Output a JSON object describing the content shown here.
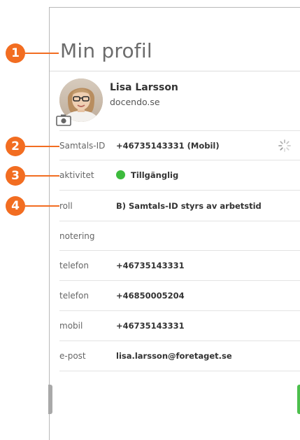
{
  "callouts": [
    "1",
    "2",
    "3",
    "4"
  ],
  "page": {
    "title": "Min profil"
  },
  "profile": {
    "name": "Lisa Larsson",
    "organization": "docendo.se"
  },
  "fields": [
    {
      "label": "Samtals-ID",
      "value": "+46735143331 (Mobil)"
    },
    {
      "label": "aktivitet",
      "value": "Tillgänglig"
    },
    {
      "label": "roll",
      "value": "B) Samtals-ID styrs av arbetstid"
    },
    {
      "label": "notering",
      "value": ""
    },
    {
      "label": "telefon",
      "value": "+46735143331"
    },
    {
      "label": "telefon",
      "value": "+46850005204"
    },
    {
      "label": "mobil",
      "value": "+46735143331"
    },
    {
      "label": "e-post",
      "value": "lisa.larsson@foretaget.se"
    }
  ],
  "colors": {
    "callout": "#f26d21",
    "available": "#3dbb3d",
    "title": "#6c6c6c"
  },
  "icons": {
    "camera": "camera-icon",
    "loading": "loading-spinner-icon"
  }
}
